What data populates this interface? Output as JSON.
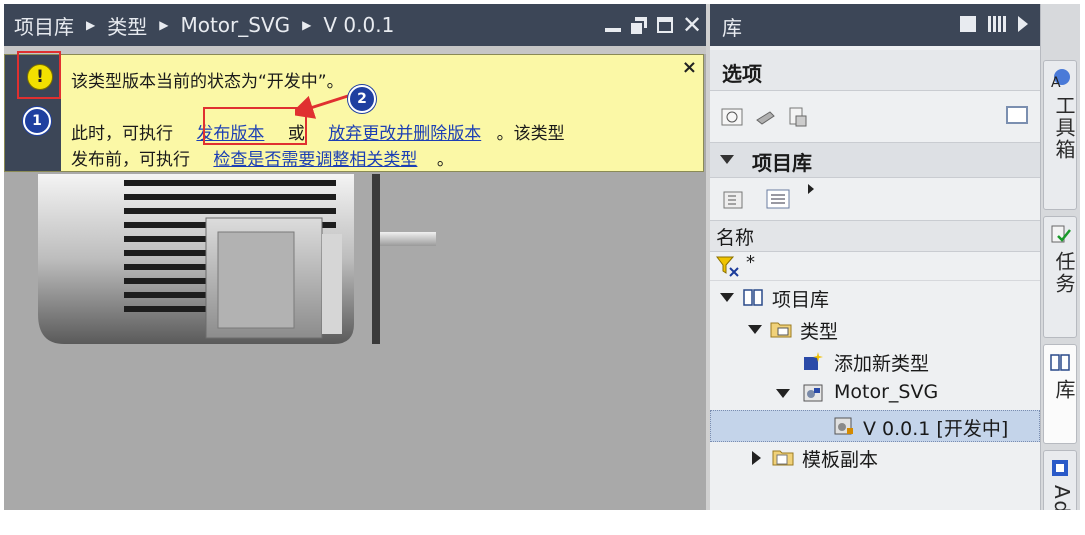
{
  "editor": {
    "breadcrumb": [
      "项目库",
      "类型",
      "Motor_SVG",
      "V 0.0.1"
    ],
    "infobar": {
      "line1": "该类型版本当前的状态为“开发中”。",
      "line2_prefix": "此时，可执行",
      "link_release": "发布版本",
      "line2_or": "或",
      "link_discard": "放弃更改并删除版本",
      "line2_suffix": "。该类型",
      "line3_prefix": "发布前，可执行",
      "link_check": "检查是否需要调整相关类型",
      "line3_suffix": "。",
      "close": "×",
      "warn_symbol": "!"
    },
    "markers": {
      "m1": "1",
      "m2": "2"
    }
  },
  "library": {
    "title": "库",
    "options_header": "选项",
    "project_library_header": "项目库",
    "name_column": "名称",
    "filter_value": "*",
    "tree": [
      {
        "label": "项目库",
        "icon": "book-icon"
      },
      {
        "label": "类型",
        "icon": "folder-types-icon"
      },
      {
        "label": "添加新类型",
        "icon": "add-type-icon"
      },
      {
        "label": "Motor_SVG",
        "icon": "type-icon"
      },
      {
        "label": "V 0.0.1 [开发中]",
        "icon": "version-icon"
      },
      {
        "label": "模板副本",
        "icon": "folder-icon"
      }
    ]
  },
  "sidetabs": {
    "toolbox": "工具箱",
    "tasks": "任务",
    "libraries": "库",
    "addins": "Ad"
  },
  "colors": {
    "title_bar": "#3c4657",
    "infobar_bg": "#fbf8a6",
    "link": "#1c3fb4",
    "marker": "#e03030",
    "badge": "#1f3fa0",
    "selection": "#c4d4ea"
  }
}
